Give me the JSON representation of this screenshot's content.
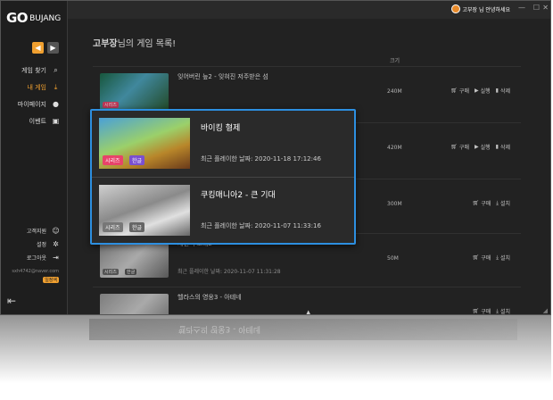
{
  "app": {
    "logo": "GO",
    "logo_sub": "BUJANG"
  },
  "sidebar": {
    "items": [
      {
        "label": "게임 찾기",
        "icon": "search-icon",
        "glyph": "⌕"
      },
      {
        "label": "내 게임",
        "icon": "download-icon",
        "glyph": "⤓"
      },
      {
        "label": "마이페이지",
        "icon": "user-icon",
        "glyph": "●"
      },
      {
        "label": "이벤트",
        "icon": "calendar-icon",
        "glyph": "▣"
      }
    ],
    "bottom": [
      {
        "label": "고객지원",
        "icon": "support-icon",
        "glyph": "☺"
      },
      {
        "label": "설정",
        "icon": "gear-icon",
        "glyph": "✲"
      },
      {
        "label": "로그아웃",
        "icon": "logout-icon",
        "glyph": "⇥"
      }
    ],
    "email": "sxh4742@naver.com",
    "badge": "일정액"
  },
  "titlebar": {
    "greeting": "고부장 님 안녕하세요"
  },
  "header": {
    "user": "고부장",
    "title_rest": "님의 게임 목록!",
    "col_size": "크기"
  },
  "rows": [
    {
      "name": "잊어버린 늪2 - 잊혀진 저주받은 섬",
      "date": "",
      "size": "240M",
      "tags": [
        "시리즈"
      ],
      "actions": [
        "구매",
        "실행",
        "삭제"
      ]
    },
    {
      "name": "",
      "date": "",
      "size": "420M",
      "tags": [],
      "actions": [
        "구매",
        "실행",
        "삭제"
      ]
    },
    {
      "name": "",
      "date": "",
      "size": "300M",
      "tags": [],
      "actions": [
        "구매",
        "설치"
      ]
    },
    {
      "name": "세넌 구조대2",
      "date": "최근 플레이한 날짜: 2020-11-07 11:31:28",
      "size": "50M",
      "tags": [
        "시리즈",
        "한글"
      ],
      "actions": [
        "구매",
        "설치"
      ]
    },
    {
      "name": "헬라스의 영웅3 - 아테네",
      "date": "",
      "size": "",
      "tags": [],
      "actions": [
        "구매",
        "설치"
      ]
    }
  ],
  "popup": [
    {
      "name": "바이킹 형제",
      "date": "최근 플레이한 날짜: 2020-11-18 17:12:46",
      "tags": [
        "시리즈",
        "한글"
      ]
    },
    {
      "name": "쿠킹매니아2 - 큰 기대",
      "date": "최근 플레이한 날짜: 2020-11-07 11:33:16",
      "tags": [
        "시리즈",
        "한글"
      ]
    }
  ],
  "reflection": {
    "text": "헬라스의 영웅3 - 아테네"
  },
  "colors": {
    "accent": "#f0a030",
    "highlight": "#2d8fe0",
    "tag_series": "#e8436a",
    "tag_korean": "#7a4fd0"
  }
}
